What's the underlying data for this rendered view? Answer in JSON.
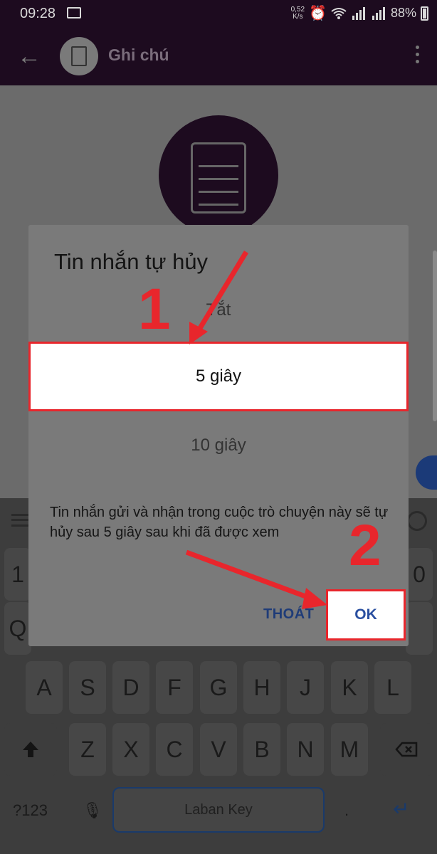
{
  "status_bar": {
    "time": "09:28",
    "net_speed_value": "0,52",
    "net_speed_unit": "K/s",
    "battery": "88%"
  },
  "app_bar": {
    "title": "Ghi chú"
  },
  "keyboard": {
    "row_numbers": [
      "1",
      "0"
    ],
    "row_qwerty_edge": [
      "Q"
    ],
    "row_home": [
      "A",
      "S",
      "D",
      "F",
      "G",
      "H",
      "J",
      "K",
      "L"
    ],
    "row_bottom": [
      "Z",
      "X",
      "C",
      "V",
      "B",
      "N",
      "M"
    ],
    "symbols_label": "?123",
    "space_label": "Laban Key"
  },
  "dialog": {
    "title": "Tin nhắn tự hủy",
    "options": {
      "off": "Tắt",
      "five": "5 giây",
      "ten": "10 giây"
    },
    "description": "Tin nhắn gửi và nhận trong cuộc trò chuyện này sẽ tự hủy sau 5 giây sau khi đã được xem",
    "cancel_label": "THOÁT",
    "ok_label": "OK"
  },
  "annotations": {
    "step1": "1",
    "step2": "2",
    "color": "#e8262c"
  }
}
